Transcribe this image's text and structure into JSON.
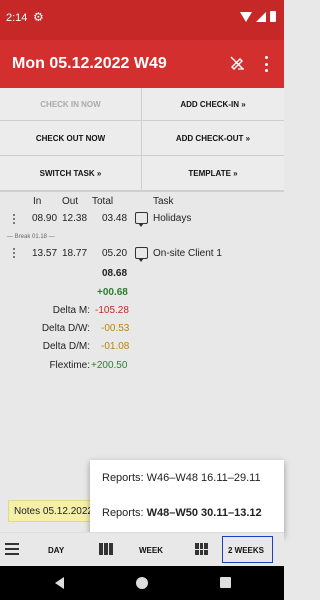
{
  "status_bar": {
    "time": "2:14"
  },
  "app_bar": {
    "title": "Mon 05.12.2022 W49"
  },
  "buttons": {
    "check_in_now": "CHECK IN NOW",
    "add_check_in": "ADD CHECK-IN »",
    "check_out_now": "CHECK OUT NOW",
    "add_check_out": "ADD CHECK-OUT »",
    "switch_task": "SWITCH TASK »",
    "template": "TEMPLATE »"
  },
  "table": {
    "headers": {
      "in": "In",
      "out": "Out",
      "total": "Total",
      "task": "Task"
    },
    "rows": [
      {
        "in": "08.90",
        "out": "12.38",
        "total": "03.48",
        "task": "Holidays"
      },
      {
        "in": "13.57",
        "out": "18.77",
        "total": "05.20",
        "task": "On-site Client 1"
      }
    ],
    "break_label": "— Break 01.18 —",
    "day_total": "08.68",
    "day_delta": "+00.68"
  },
  "summary": [
    {
      "label": "Delta M:",
      "value": "-105.28",
      "color": "#c62828"
    },
    {
      "label": "Delta D/W:",
      "value": "-00.53",
      "color": "#b8860b"
    },
    {
      "label": "Delta D/M:",
      "value": "-01.08",
      "color": "#b8860b"
    },
    {
      "label": "Flextime:",
      "value": "+200.50",
      "color": "#2e7d32"
    }
  ],
  "popup": {
    "item1": "Reports: W46–W48 16.11–29.11",
    "item2_prefix": "Reports: ",
    "item2_bold": "W48–W50 30.11–13.12"
  },
  "notes": "Notes 05.12.2022",
  "bottom_tabs": {
    "day": "DAY",
    "week": "WEEK",
    "two_weeks": "2 WEEKS"
  }
}
